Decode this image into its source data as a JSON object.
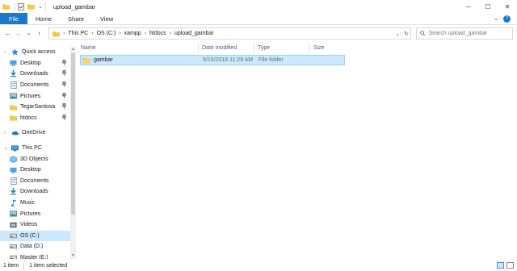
{
  "window": {
    "title": "upload_gambar",
    "controls": {
      "minimize": "─",
      "maximize": "☐",
      "close": "✕"
    }
  },
  "ribbon": {
    "tabs": [
      "File",
      "Home",
      "Share",
      "View"
    ],
    "collapse_glyph": "⌄",
    "help_glyph": "?"
  },
  "nav": {
    "back": "←",
    "forward": "→",
    "recent": "⌄",
    "up": "↑"
  },
  "address": {
    "crumbs": [
      "This PC",
      "OS (C:)",
      "xampp",
      "htdocs",
      "upload_gambar"
    ],
    "separator": "›",
    "dropdown_glyph": "⌄",
    "refresh_glyph": "↻"
  },
  "search": {
    "placeholder": "Search upload_gambar"
  },
  "sidebar": {
    "items": [
      {
        "label": "Quick access",
        "icon": "star-icon",
        "level": 1,
        "expander": "›"
      },
      {
        "label": "Desktop",
        "icon": "desktop-icon",
        "level": 2,
        "pinned": true
      },
      {
        "label": "Downloads",
        "icon": "download-icon",
        "level": 2,
        "pinned": true
      },
      {
        "label": "Documents",
        "icon": "documents-icon",
        "level": 2,
        "pinned": true
      },
      {
        "label": "Pictures",
        "icon": "pictures-icon",
        "level": 2,
        "pinned": true
      },
      {
        "label": "TegarSantosa",
        "icon": "folder-icon",
        "level": 2,
        "pinned": true
      },
      {
        "label": "htdocs",
        "icon": "folder-icon",
        "level": 2,
        "pinned": true
      },
      {
        "label": "OneDrive",
        "icon": "cloud-icon",
        "level": 1,
        "expander": "›",
        "gap_before": true
      },
      {
        "label": "This PC",
        "icon": "computer-icon",
        "level": 1,
        "expander": "⌄",
        "gap_before": true
      },
      {
        "label": "3D Objects",
        "icon": "cube-icon",
        "level": 2
      },
      {
        "label": "Desktop",
        "icon": "desktop-icon",
        "level": 2
      },
      {
        "label": "Documents",
        "icon": "documents-icon",
        "level": 2
      },
      {
        "label": "Downloads",
        "icon": "download-icon",
        "level": 2
      },
      {
        "label": "Music",
        "icon": "music-icon",
        "level": 2
      },
      {
        "label": "Pictures",
        "icon": "pictures-icon",
        "level": 2
      },
      {
        "label": "Videos",
        "icon": "video-icon",
        "level": 2
      },
      {
        "label": "OS (C:)",
        "icon": "drive-icon",
        "level": 2,
        "selected": true
      },
      {
        "label": "Data (D:)",
        "icon": "drive-icon",
        "level": 2
      },
      {
        "label": "Master (E:)",
        "icon": "drive-icon",
        "level": 2
      }
    ],
    "pin_glyph": "📌"
  },
  "columns": [
    "Name",
    "Date modified",
    "Type",
    "Size"
  ],
  "files": [
    {
      "name": "gambar",
      "date_modified": "5/15/2018 11:29 AM",
      "type": "File folder",
      "size": ""
    }
  ],
  "status": {
    "item_count": "1 item",
    "selection": "1 item selected"
  },
  "colors": {
    "accent": "#1979ca",
    "selection": "#cce8ff",
    "folder": "#f2c94c"
  }
}
